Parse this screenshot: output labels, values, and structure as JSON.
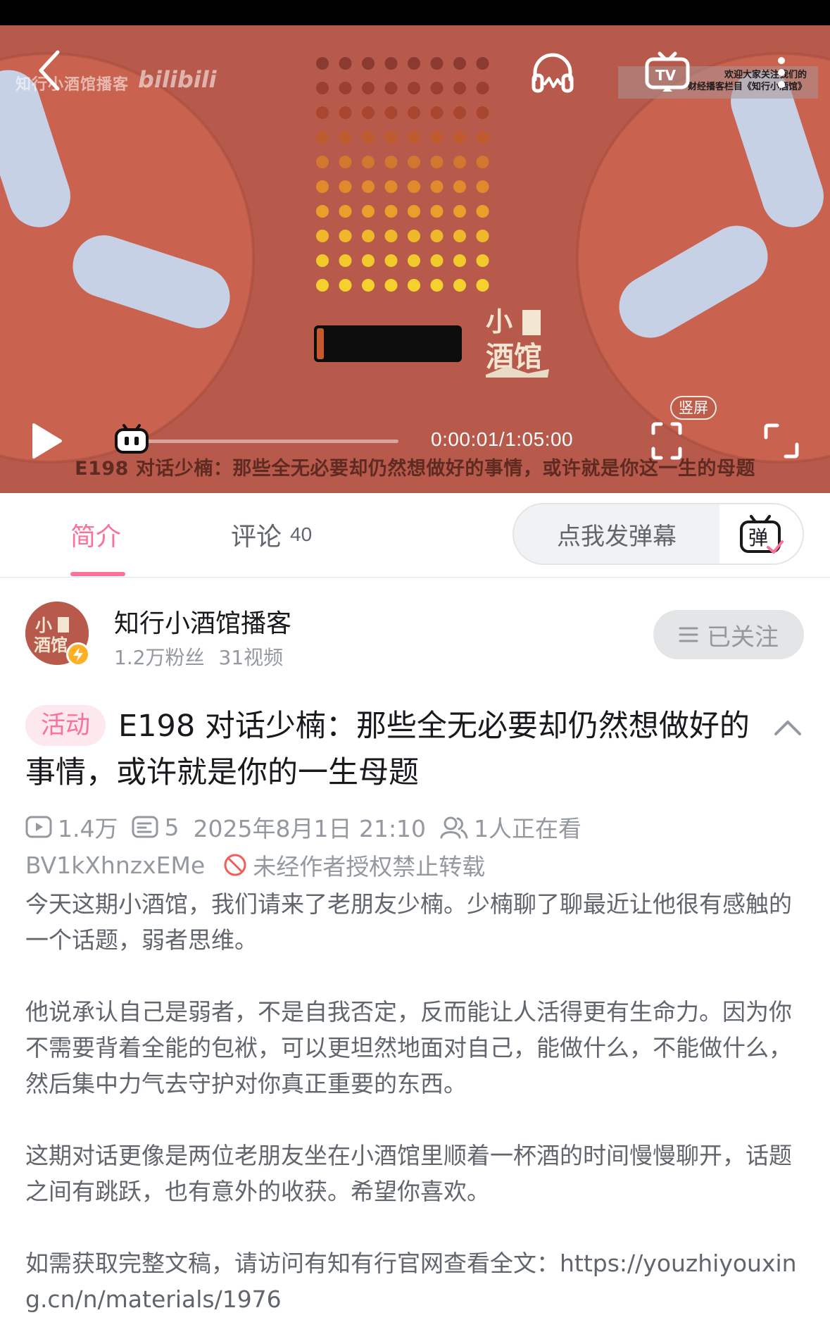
{
  "player": {
    "watermark_text": "知行小酒馆播客",
    "watermark_logo": "bilibili",
    "notice_line1": "欢迎大家关注我们的",
    "notice_line2": "财经播客栏目《知行小酒馆》",
    "subtitle": "E198 对话少楠：那些全无必要却仍然想做好的事情，或许就是你这一生的母题",
    "time_display": "0:00:01/1:05:00",
    "progress": 0.0003,
    "vertical_label": "竖屏",
    "icons": [
      "back-icon",
      "headphones-icon",
      "tv-cast-icon",
      "more-vertical-icon",
      "play-icon",
      "tv-mascot-icon",
      "vertical-fullscreen-icon",
      "fullscreen-icon"
    ]
  },
  "tabs": {
    "intro_label": "简介",
    "comments_label": "评论",
    "comments_count": "40",
    "danmaku_placeholder": "点我发弹幕",
    "danmaku_toggle_char": "弹"
  },
  "uploader": {
    "name": "知行小酒馆播客",
    "fans": "1.2万粉丝",
    "videos": "31视频",
    "follow_label": "已关注"
  },
  "video": {
    "event_tag": "活动",
    "title": "E198 对话少楠：那些全无必要却仍然想做好的事情，或许就是你的一生母题",
    "views": "1.4万",
    "danmaku_count": "5",
    "publish_time": "2025年8月1日 21:10",
    "watching_now": "1人正在看",
    "bvid": "BV1kXhnzxEMe",
    "copyright_notice": "未经作者授权禁止转载"
  },
  "description": [
    "今天这期小酒馆，我们请来了老朋友少楠。少楠聊了聊最近让他很有感触的一个话题，弱者思维。",
    "他说承认自己是弱者，不是自我否定，反而能让人活得更有生命力。因为你不需要背着全能的包袱，可以更坦然地面对自己，能做什么，不能做什么，然后集中力气去守护对你真正重要的东西。",
    "这期对话更像是两位老朋友坐在小酒馆里顺着一杯酒的时间慢慢聊开，话题之间有跳跃，也有意外的收获。希望你喜欢。",
    "如需获取完整文稿，请访问有知有行官网查看全文：https://youzhiyouxing.cn/n/materials/1976"
  ],
  "colors": {
    "accent": "#fb7299",
    "video_bg": "#b85a4b",
    "text_primary": "#18191c",
    "text_secondary": "#61666d",
    "text_muted": "#9499a0"
  }
}
